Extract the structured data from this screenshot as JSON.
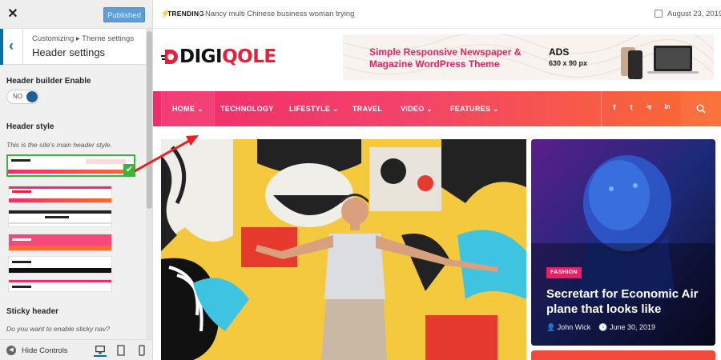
{
  "customizer": {
    "close_icon": "close-icon",
    "published_label": "Published",
    "breadcrumb": "Customizing ▸ Theme settings",
    "section_title": "Header settings",
    "header_builder_label": "Header builder Enable",
    "toggle_state": "NO",
    "header_style_label": "Header style",
    "header_style_desc": "This is the site's main header style.",
    "selected_style_index": 0,
    "sticky_label": "Sticky header",
    "sticky_desc": "Do you want to enable sticky nav?",
    "hide_controls_label": "Hide Controls",
    "selected_color": "#3cb43c",
    "accent_color": "#0073aa"
  },
  "site": {
    "trending_label": "TRENDING",
    "trending_text": "Nancy multi Chinese business woman trying",
    "date": "August 23, 2019",
    "logo_dark": "DIGI",
    "logo_red": "QOLE",
    "ad_title": "Simple Responsive Newspaper & Magazine WordPress Theme",
    "ad_label": "ADS",
    "ad_size": "630 x 90 px",
    "nav": [
      {
        "label": "HOME ⌄"
      },
      {
        "label": "TECHNOLOGY"
      },
      {
        "label": "LIFESTYLE ⌄"
      },
      {
        "label": "TRAVEL"
      },
      {
        "label": "VIDEO ⌄"
      },
      {
        "label": "FEATURES ⌄"
      }
    ],
    "social": [
      "f",
      "t",
      "ig",
      "in"
    ],
    "brand_color": "#e91e3a",
    "featured_post": {
      "tag": "FASHION",
      "title": "Secretart for Economic Air plane that looks like",
      "author": "John Wick",
      "date": "June 30, 2019"
    }
  }
}
